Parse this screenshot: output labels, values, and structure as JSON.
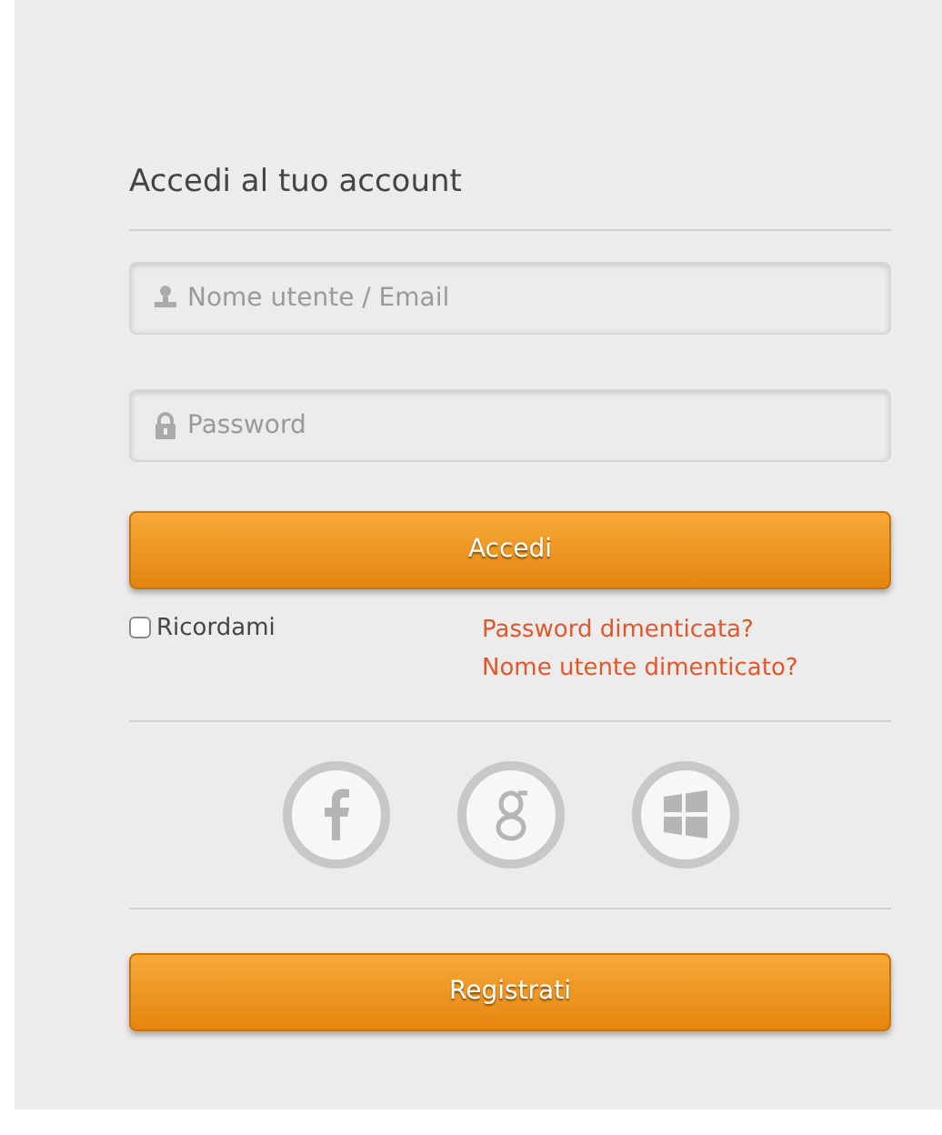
{
  "title": "Accedi al tuo account",
  "fields": [
    {
      "kind": "user",
      "placeholder": "Nome utente / Email"
    },
    {
      "kind": "password",
      "placeholder": "Password"
    }
  ],
  "login_button": "Accedi",
  "remember": {
    "label": "Ricordami",
    "checked": false
  },
  "links": [
    "Password dimenticata?",
    "Nome utente dimenticato?"
  ],
  "register_button": "Registrati"
}
